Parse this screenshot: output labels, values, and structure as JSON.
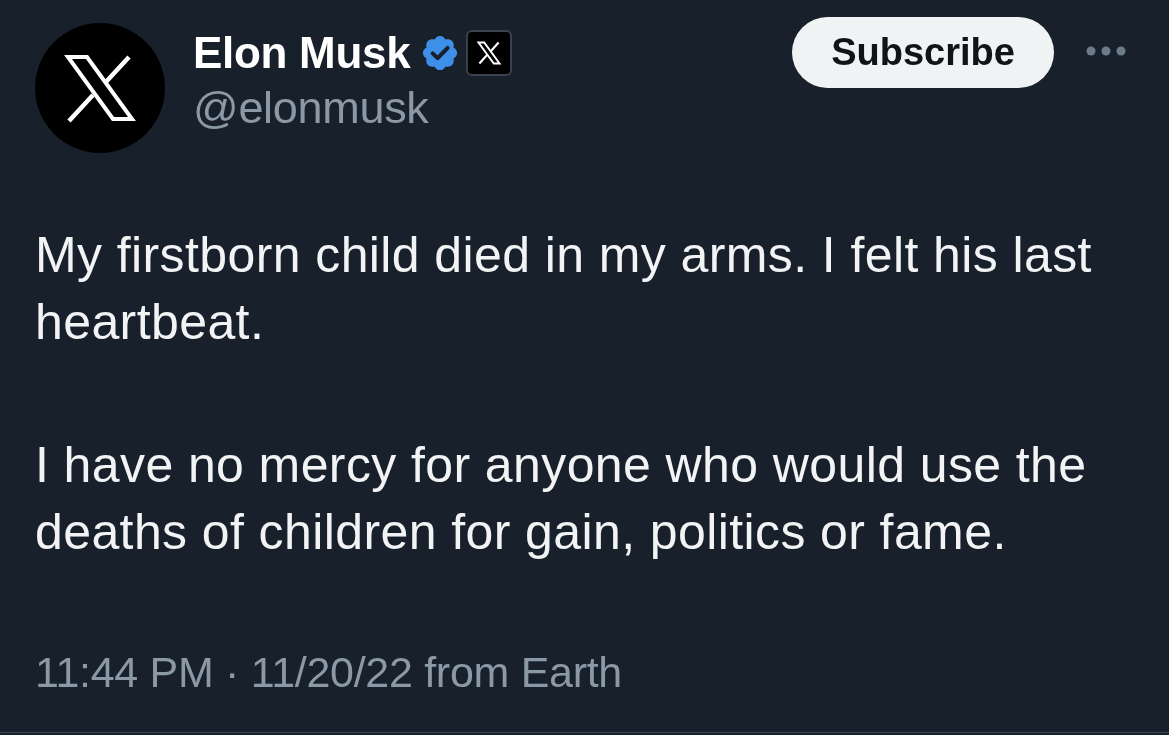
{
  "tweet": {
    "author": {
      "name": "Elon Musk",
      "verified": true,
      "affiliated": true,
      "handle": "@elonmusk"
    },
    "subscribe_button": {
      "label": "Subscribe"
    },
    "paragraphs": [
      "My firstborn child died in my arms. I felt his last heartbeat.",
      "I have no mercy for anyone who would use the deaths of children for gain, politics or fame."
    ],
    "timestamp": "11:44 PM · 11/20/22 from Earth"
  }
}
